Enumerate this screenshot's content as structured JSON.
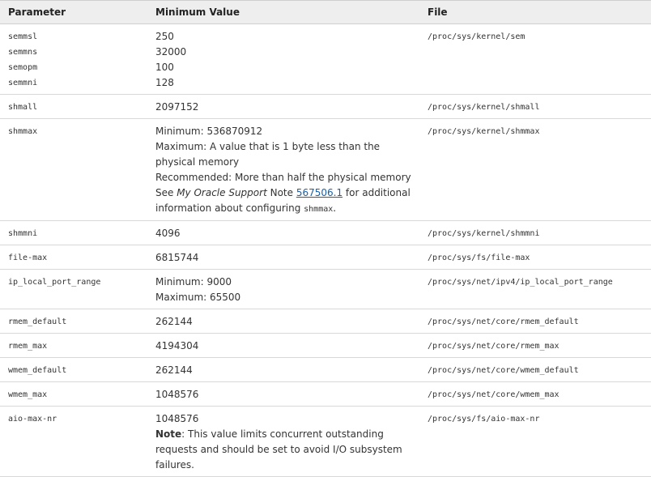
{
  "headers": {
    "parameter": "Parameter",
    "minimum_value": "Minimum Value",
    "file": "File"
  },
  "rows": {
    "sem": {
      "params": [
        "semmsl",
        "semmns",
        "semopm",
        "semmni"
      ],
      "values": [
        "250",
        "32000",
        "100",
        "128"
      ],
      "file": "/proc/sys/kernel/sem"
    },
    "shmall": {
      "param": "shmall",
      "value": "2097152",
      "file": "/proc/sys/kernel/shmall"
    },
    "shmmax": {
      "param": "shmmax",
      "min_line": "Minimum: 536870912",
      "max_line": "Maximum: A value that is 1 byte less than the physical memory",
      "rec_line": "Recommended: More than half the physical memory",
      "see_prefix": "See ",
      "see_italic": "My Oracle Support",
      "see_note": " Note ",
      "see_link": "567506.1",
      "see_suffix": " for additional information about configuring ",
      "see_code": "shmmax",
      "see_end": ".",
      "file": "/proc/sys/kernel/shmmax"
    },
    "shmmni": {
      "param": "shmmni",
      "value": "4096",
      "file": "/proc/sys/kernel/shmmni"
    },
    "file_max": {
      "param": "file-max",
      "value": "6815744",
      "file": "/proc/sys/fs/file-max"
    },
    "ip_local_port_range": {
      "param": "ip_local_port_range",
      "min_line": "Minimum: 9000",
      "max_line": "Maximum: 65500",
      "file": "/proc/sys/net/ipv4/ip_local_port_range"
    },
    "rmem_default": {
      "param": "rmem_default",
      "value": "262144",
      "file": "/proc/sys/net/core/rmem_default"
    },
    "rmem_max": {
      "param": "rmem_max",
      "value": "4194304",
      "file": "/proc/sys/net/core/rmem_max"
    },
    "wmem_default": {
      "param": "wmem_default",
      "value": "262144",
      "file": "/proc/sys/net/core/wmem_default"
    },
    "wmem_max": {
      "param": "wmem_max",
      "value": "1048576",
      "file": "/proc/sys/net/core/wmem_max"
    },
    "aio_max_nr": {
      "param": "aio-max-nr",
      "value": "1048576",
      "note_label": "Note",
      "note_text": ": This value limits concurrent outstanding requests and should be set to avoid I/O subsystem failures.",
      "file": "/proc/sys/fs/aio-max-nr"
    }
  }
}
